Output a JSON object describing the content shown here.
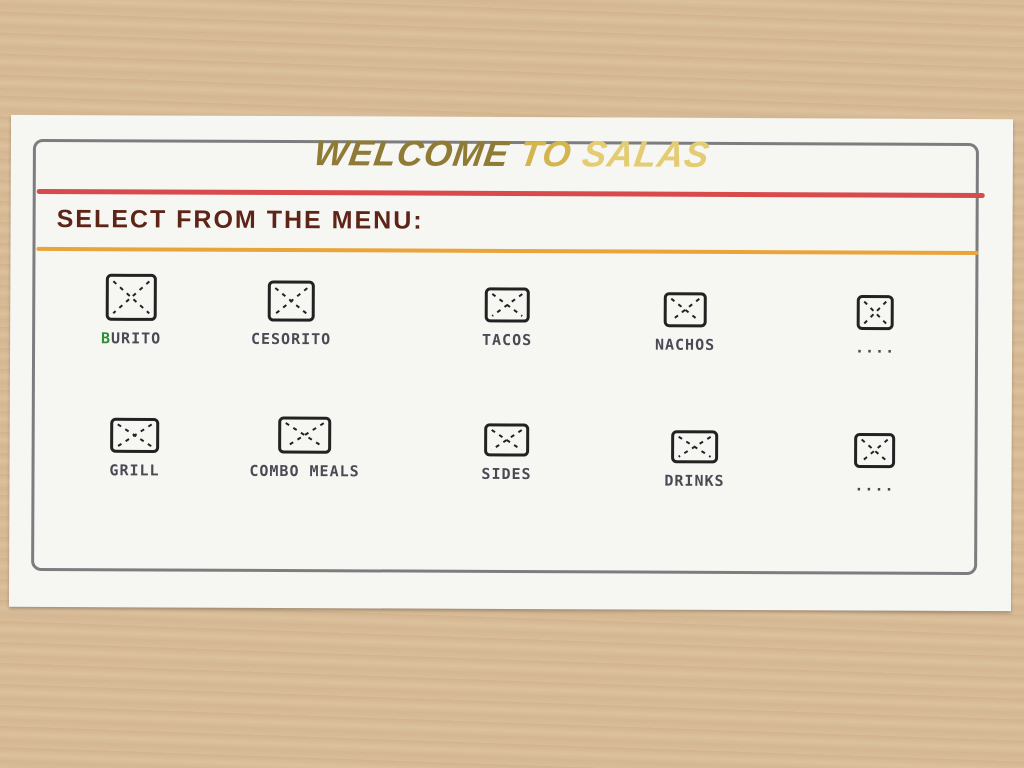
{
  "header": {
    "title_words": [
      "WELCOME",
      "TO",
      "SALAS"
    ],
    "subtitle": "SELECT FROM THE MENU:"
  },
  "menu": {
    "row1": [
      {
        "label_first": "B",
        "label_rest": "URITO",
        "icon": "image-placeholder-icon"
      },
      {
        "label": "CESORITO",
        "icon": "image-placeholder-icon"
      },
      {
        "label": "TACOS",
        "icon": "image-placeholder-icon"
      },
      {
        "label": "NACHOS",
        "icon": "image-placeholder-icon"
      },
      {
        "label": "....",
        "icon": "image-placeholder-icon"
      }
    ],
    "row2": [
      {
        "label": "GRILL",
        "icon": "image-placeholder-icon"
      },
      {
        "label": "COMBO MEALS",
        "icon": "image-placeholder-icon"
      },
      {
        "label": "SIDES",
        "icon": "image-placeholder-icon"
      },
      {
        "label": "DRINKS",
        "icon": "image-placeholder-icon"
      },
      {
        "label": "....",
        "icon": "image-placeholder-icon"
      }
    ]
  },
  "colors": {
    "title_dark_gold": "#8f7b35",
    "title_gold": "#d3b44d",
    "rule_red": "#d84a4c",
    "rule_orange": "#eaa43a",
    "subtitle": "#5d2417",
    "highlight_green": "#2e8f36"
  }
}
